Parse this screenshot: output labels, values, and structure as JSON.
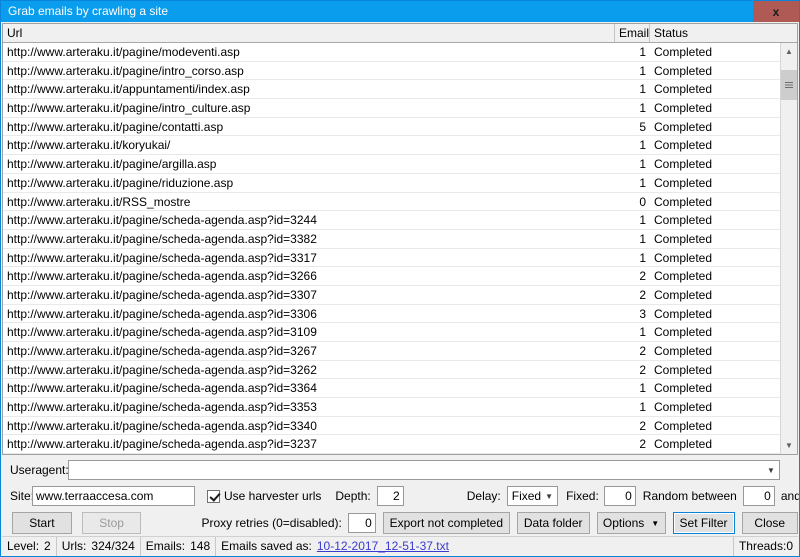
{
  "window": {
    "title": "Grab emails by crawling a site",
    "close_label": "x",
    "titlebar_color": "#0a9ced",
    "close_color": "#b05a55"
  },
  "list": {
    "columns": [
      "Url",
      "Emails",
      "Status"
    ],
    "rows": [
      {
        "url": "http://www.arteraku.it/pagine/modeventi.asp",
        "emails": "1",
        "status": "Completed"
      },
      {
        "url": "http://www.arteraku.it/pagine/intro_corso.asp",
        "emails": "1",
        "status": "Completed"
      },
      {
        "url": "http://www.arteraku.it/appuntamenti/index.asp",
        "emails": "1",
        "status": "Completed"
      },
      {
        "url": "http://www.arteraku.it/pagine/intro_culture.asp",
        "emails": "1",
        "status": "Completed"
      },
      {
        "url": "http://www.arteraku.it/pagine/contatti.asp",
        "emails": "5",
        "status": "Completed"
      },
      {
        "url": "http://www.arteraku.it/koryukai/",
        "emails": "1",
        "status": "Completed"
      },
      {
        "url": "http://www.arteraku.it/pagine/argilla.asp",
        "emails": "1",
        "status": "Completed"
      },
      {
        "url": "http://www.arteraku.it/pagine/riduzione.asp",
        "emails": "1",
        "status": "Completed"
      },
      {
        "url": "http://www.arteraku.it/RSS_mostre",
        "emails": "0",
        "status": "Completed"
      },
      {
        "url": "http://www.arteraku.it/pagine/scheda-agenda.asp?id=3244",
        "emails": "1",
        "status": "Completed"
      },
      {
        "url": "http://www.arteraku.it/pagine/scheda-agenda.asp?id=3382",
        "emails": "1",
        "status": "Completed"
      },
      {
        "url": "http://www.arteraku.it/pagine/scheda-agenda.asp?id=3317",
        "emails": "1",
        "status": "Completed"
      },
      {
        "url": "http://www.arteraku.it/pagine/scheda-agenda.asp?id=3266",
        "emails": "2",
        "status": "Completed"
      },
      {
        "url": "http://www.arteraku.it/pagine/scheda-agenda.asp?id=3307",
        "emails": "2",
        "status": "Completed"
      },
      {
        "url": "http://www.arteraku.it/pagine/scheda-agenda.asp?id=3306",
        "emails": "3",
        "status": "Completed"
      },
      {
        "url": "http://www.arteraku.it/pagine/scheda-agenda.asp?id=3109",
        "emails": "1",
        "status": "Completed"
      },
      {
        "url": "http://www.arteraku.it/pagine/scheda-agenda.asp?id=3267",
        "emails": "2",
        "status": "Completed"
      },
      {
        "url": "http://www.arteraku.it/pagine/scheda-agenda.asp?id=3262",
        "emails": "2",
        "status": "Completed"
      },
      {
        "url": "http://www.arteraku.it/pagine/scheda-agenda.asp?id=3364",
        "emails": "1",
        "status": "Completed"
      },
      {
        "url": "http://www.arteraku.it/pagine/scheda-agenda.asp?id=3353",
        "emails": "1",
        "status": "Completed"
      },
      {
        "url": "http://www.arteraku.it/pagine/scheda-agenda.asp?id=3340",
        "emails": "2",
        "status": "Completed"
      },
      {
        "url": "http://www.arteraku.it/pagine/scheda-agenda.asp?id=3237",
        "emails": "2",
        "status": "Completed"
      }
    ]
  },
  "settings": {
    "useragent_label": "Useragent:",
    "useragent_value": "",
    "site_label": "Site:",
    "site_value": "www.terraaccesa.com",
    "use_harvester_label": "Use harvester urls",
    "use_harvester_checked": true,
    "depth_label": "Depth:",
    "depth_value": "2",
    "delay_label": "Delay:",
    "delay_value": "Fixed",
    "fixed_label": "Fixed:",
    "fixed_value": "0",
    "random_label": "Random between",
    "random_from": "0",
    "random_and_label": "and",
    "random_to": "0",
    "proxy_retries_label": "Proxy retries (0=disabled):",
    "proxy_retries_value": "0"
  },
  "buttons": {
    "start": "Start",
    "stop": "Stop",
    "export_not_completed": "Export not completed",
    "data_folder": "Data folder",
    "options": "Options",
    "set_filter": "Set Filter",
    "close": "Close"
  },
  "statusbar": {
    "level_label": "Level:",
    "level_value": "2",
    "urls_label": "Urls:",
    "urls_value": "324/324",
    "emails_label": "Emails:",
    "emails_value": "148",
    "saved_label": "Emails saved as:",
    "saved_value": "10-12-2017_12-51-37.txt",
    "threads_label": "Threads:",
    "threads_value": "0"
  }
}
